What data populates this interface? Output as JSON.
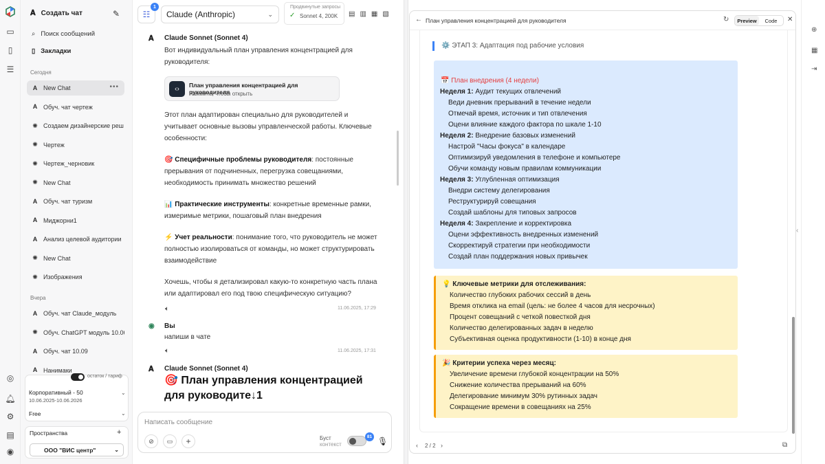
{
  "sidebar": {
    "new_chat": "Создать чат",
    "search": "Поиск сообщений",
    "bookmarks": "Закладки",
    "today": "Сегодня",
    "yesterday": "Вчера",
    "items_today": [
      {
        "label": "New Chat",
        "icon": "anthropic-icon"
      },
      {
        "label": "Обуч. чат чертеж",
        "icon": "anthropic-icon"
      },
      {
        "label": "Создаем дизайнерские реш",
        "icon": "openai-icon"
      },
      {
        "label": "Чертеж",
        "icon": "openai-icon"
      },
      {
        "label": "Чертеж_черновик",
        "icon": "openai-icon"
      },
      {
        "label": "New Chat",
        "icon": "openai-icon"
      },
      {
        "label": "Обуч. чат туризм",
        "icon": "anthropic-icon"
      },
      {
        "label": "Миджорни1",
        "icon": "anthropic-icon"
      },
      {
        "label": "Анализ целевой аудитории",
        "icon": "anthropic-icon"
      },
      {
        "label": "New Chat",
        "icon": "openai-icon"
      },
      {
        "label": "Изображения",
        "icon": "openai-icon"
      }
    ],
    "items_yesterday": [
      {
        "label": "Обуч. чат Claude_модуль",
        "icon": "anthropic-icon"
      },
      {
        "label": "Обуч. ChatGPT модуль 10.06",
        "icon": "openai-icon"
      },
      {
        "label": "Обуч. чат 10.09",
        "icon": "anthropic-icon"
      },
      {
        "label": "Нанимаки",
        "icon": "anthropic-icon"
      }
    ],
    "plan": {
      "toggle_label": "остаток / тариф",
      "name": "Корпоративный - 50",
      "dates": "10.06.2025-10.06.2026",
      "tier": "Free"
    },
    "spaces": {
      "title": "Пространства",
      "org": "ООО \"ВИС центр\""
    }
  },
  "header": {
    "menu_badge": "1",
    "model": "Claude (Anthropic)",
    "requests_label": "Продвинутые запросы",
    "requests_value": "Sonnet 4, 200K"
  },
  "messages": {
    "m1_author": "Claude Sonnet (Sonnet 4)",
    "m1_intro": "Вот индивидуальный план управления концентрацией для руководителя:",
    "artifact_title": "План управления концентрацией для руководителя",
    "artifact_sub": "Нажмите, чтобы открыть",
    "m1_p2": "Этот план адаптирован специально для руководителей и учитывает основные вызовы управленческой работы. Ключевые особенности:",
    "f1_icon": "🎯",
    "f1_title": "Специфичные проблемы руководителя",
    "f1_text": ": постоянные прерывания от подчиненных, перегрузка совещаниями, необходимость принимать множество решений",
    "f2_icon": "📊",
    "f2_title": "Практические инструменты",
    "f2_text": ": конкретные временные рамки, измеримые метрики, пошаговый план внедрения",
    "f3_icon": "⚡",
    "f3_title": "Учет реальности",
    "f3_text": ": понимание того, что руководитель не может полностью изолироваться от команды, но может структурировать взаимодействие",
    "m1_q": "Хочешь, чтобы я детализировал какую-то конкретную часть плана или адаптировал его под твою специфическую ситуацию?",
    "m1_time": "11.06.2025, 17:29",
    "m2_author": "Вы",
    "m2_text": "напиши в чате",
    "m2_time": "11.06.2025, 17:31",
    "m3_author": "Claude Sonnet (Sonnet 4)",
    "m3_heading": "🎯 План управления концентрацией для руководите↓1"
  },
  "composer": {
    "placeholder": "Написать сообщение",
    "boost_1": "Буст",
    "boost_2": "контекст",
    "boost_badge": "81"
  },
  "panel": {
    "title": "План управления концентрацией для руководителя",
    "tab_preview": "Preview",
    "tab_code": "Code",
    "stage": "⚙️ ЭТАП 3: Адаптация под рабочие условия",
    "plan_title": "📅 План внедрения (4 недели)",
    "w1_h": "Неделя 1:",
    "w1_t": " Аудит текущих отвлечений",
    "w1_items": [
      "Веди дневник прерываний в течение недели",
      "Отмечай время, источник и тип отвлечения",
      "Оцени влияние каждого фактора по шкале 1-10"
    ],
    "w2_h": "Неделя 2:",
    "w2_t": " Внедрение базовых изменений",
    "w2_items": [
      "Настрой \"Часы фокуса\" в календаре",
      "Оптимизируй уведомления в телефоне и компьютере",
      "Обучи команду новым правилам коммуникации"
    ],
    "w3_h": "Неделя 3:",
    "w3_t": " Углубленная оптимизация",
    "w3_items": [
      "Внедри систему делегирования",
      "Реструктурируй совещания",
      "Создай шаблоны для типовых запросов"
    ],
    "w4_h": "Неделя 4:",
    "w4_t": " Закрепление и корректировка",
    "w4_items": [
      "Оцени эффективность внедренных изменений",
      "Скорректируй стратегии при необходимости",
      "Создай план поддержания новых привычек"
    ],
    "metrics_title": "💡 Ключевые метрики для отслеживания:",
    "metrics": [
      "Количество глубоких рабочих сессий в день",
      "Время отклика на email (цель: не более 4 часов для несрочных)",
      "Процент совещаний с четкой повесткой дня",
      "Количество делегированных задач в неделю",
      "Субъективная оценка продуктивности (1-10) в конце дня"
    ],
    "criteria_title": "🎉 Критерии успеха через месяц:",
    "criteria": [
      "Увеличение времени глубокой концентрации на 50%",
      "Снижение количества прерываний на 60%",
      "Делегирование минимум 30% рутинных задач",
      "Сокращение времени в совещаниях на 25%"
    ],
    "pager": "2 / 2"
  },
  "colors": {
    "accent": "#3b82f6",
    "plan_bg": "#dbeafe",
    "metrics_bg": "#fef3c7",
    "border_accent": "#f59e0b",
    "plan_title": "#e53e3e"
  }
}
